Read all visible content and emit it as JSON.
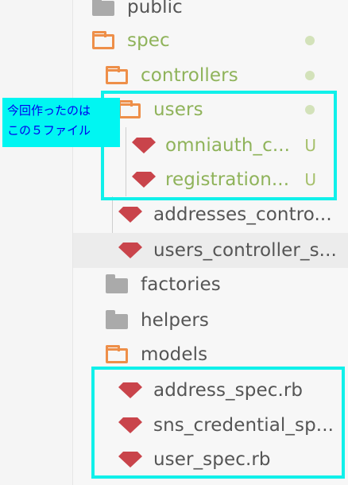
{
  "tree": {
    "items": [
      {
        "label": "public",
        "type": "folder",
        "state": "closed",
        "icon": "folder-closed-icon",
        "status": null
      },
      {
        "label": "spec",
        "type": "folder",
        "state": "open",
        "icon": "folder-open-icon",
        "status": "dot"
      },
      {
        "label": "controllers",
        "type": "folder",
        "state": "open",
        "icon": "folder-open-icon",
        "status": "dot"
      },
      {
        "label": "users",
        "type": "folder",
        "state": "open",
        "icon": "folder-open-icon",
        "status": "dot"
      },
      {
        "label": "omniauth_c...",
        "type": "ruby-file",
        "icon": "ruby-icon",
        "status": "U"
      },
      {
        "label": "registration...",
        "type": "ruby-file",
        "icon": "ruby-icon",
        "status": "U"
      },
      {
        "label": "addresses_contro...",
        "type": "ruby-file",
        "icon": "ruby-icon",
        "status": null
      },
      {
        "label": "users_controller_s...",
        "type": "ruby-file",
        "icon": "ruby-icon",
        "status": null
      },
      {
        "label": "factories",
        "type": "folder",
        "state": "closed",
        "icon": "folder-closed-icon",
        "status": null
      },
      {
        "label": "helpers",
        "type": "folder",
        "state": "closed",
        "icon": "folder-closed-icon",
        "status": null
      },
      {
        "label": "models",
        "type": "folder",
        "state": "open",
        "icon": "folder-open-icon",
        "status": null
      },
      {
        "label": "address_spec.rb",
        "type": "ruby-file",
        "icon": "ruby-icon",
        "status": null
      },
      {
        "label": "sns_credential_sp...",
        "type": "ruby-file",
        "icon": "ruby-icon",
        "status": null
      },
      {
        "label": "user_spec.rb",
        "type": "ruby-file",
        "icon": "ruby-icon",
        "status": null
      }
    ]
  },
  "annotation": {
    "line1": "今回作ったのは",
    "line2": "この５ファイル"
  },
  "colors": {
    "folder_open": "#ee8f49",
    "folder_closed": "#aaaaaa",
    "ruby": "#c9444b",
    "added_text": "#8fb35a",
    "highlight": "#10f0ea",
    "note_bg": "#00f6f2",
    "note_text": "#0000ee"
  }
}
